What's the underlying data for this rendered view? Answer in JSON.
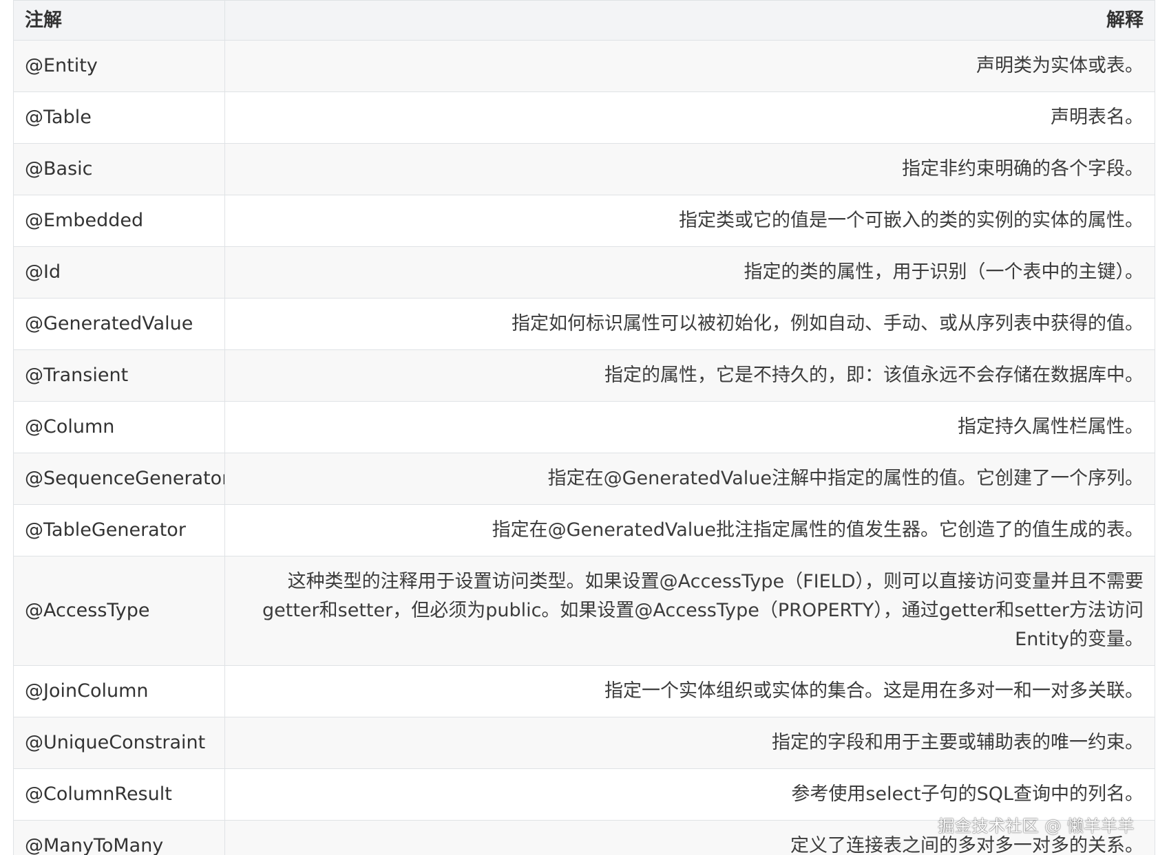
{
  "table": {
    "headers": {
      "annotation": "注解",
      "description": "解释"
    },
    "rows": [
      {
        "annotation": "@Entity",
        "description": "声明类为实体或表。"
      },
      {
        "annotation": "@Table",
        "description": "声明表名。"
      },
      {
        "annotation": "@Basic",
        "description": "指定非约束明确的各个字段。"
      },
      {
        "annotation": "@Embedded",
        "description": "指定类或它的值是一个可嵌入的类的实例的实体的属性。"
      },
      {
        "annotation": "@Id",
        "description": "指定的类的属性，用于识别（一个表中的主键）。"
      },
      {
        "annotation": "@GeneratedValue",
        "description": "指定如何标识属性可以被初始化，例如自动、手动、或从序列表中获得的值。"
      },
      {
        "annotation": "@Transient",
        "description": "指定的属性，它是不持久的，即：该值永远不会存储在数据库中。"
      },
      {
        "annotation": "@Column",
        "description": "指定持久属性栏属性。"
      },
      {
        "annotation": "@SequenceGenerator",
        "description": "指定在@GeneratedValue注解中指定的属性的值。它创建了一个序列。"
      },
      {
        "annotation": "@TableGenerator",
        "description": "指定在@GeneratedValue批注指定属性的值发生器。它创造了的值生成的表。"
      },
      {
        "annotation": "@AccessType",
        "description": "这种类型的注释用于设置访问类型。如果设置@AccessType（FIELD），则可以直接访问变量并且不需要getter和setter，但必须为public。如果设置@AccessType（PROPERTY），通过getter和setter方法访问Entity的变量。"
      },
      {
        "annotation": "@JoinColumn",
        "description": "指定一个实体组织或实体的集合。这是用在多对一和一对多关联。"
      },
      {
        "annotation": "@UniqueConstraint",
        "description": "指定的字段和用于主要或辅助表的唯一约束。"
      },
      {
        "annotation": "@ColumnResult",
        "description": "参考使用select子句的SQL查询中的列名。"
      },
      {
        "annotation": "@ManyToMany",
        "description": "定义了连接表之间的多对多一对多的关系。"
      }
    ]
  },
  "watermark": "掘金技术社区 @ 懒羊羊羊"
}
